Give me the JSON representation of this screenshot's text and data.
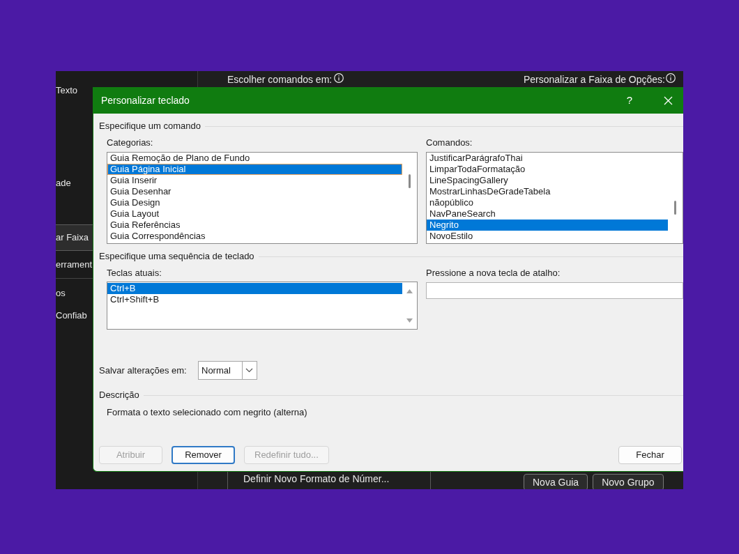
{
  "options_window": {
    "sidebar": [
      {
        "label": "Texto",
        "selected": false
      },
      {
        "label": "ade",
        "selected": false
      },
      {
        "label": "ar Faixa",
        "selected": true
      },
      {
        "label": "errament",
        "selected": false
      },
      {
        "label": "os",
        "selected": false
      },
      {
        "label": "Confiab",
        "selected": false
      }
    ],
    "choose_commands_label": "Escolher comandos em:",
    "customize_ribbon_label": "Personalizar a Faixa de Opções:",
    "commands_list": [
      "Definir Novo Formato de Númer..."
    ],
    "ribbon_buttons": [
      "Nova Guia",
      "Novo Grupo"
    ]
  },
  "dialog": {
    "title": "Personalizar teclado",
    "help_button": "?",
    "command_group": "Especifique um comando",
    "categories": {
      "label": "Categorias:",
      "focused": true,
      "items": [
        {
          "text": "Guia Remoção de Plano de Fundo",
          "selected": false
        },
        {
          "text": "Guia Página Inicial",
          "selected": true
        },
        {
          "text": "Guia Inserir",
          "selected": false
        },
        {
          "text": "Guia Desenhar",
          "selected": false
        },
        {
          "text": "Guia Design",
          "selected": false
        },
        {
          "text": "Guia Layout",
          "selected": false
        },
        {
          "text": "Guia Referências",
          "selected": false
        },
        {
          "text": "Guia Correspondências",
          "selected": false
        }
      ]
    },
    "commands": {
      "label": "Comandos:",
      "focused": false,
      "items": [
        {
          "text": "JustificarParágrafoThai",
          "selected": false
        },
        {
          "text": "LimparTodaFormatação",
          "selected": false
        },
        {
          "text": "LineSpacingGallery",
          "selected": false
        },
        {
          "text": "MostrarLinhasDeGradeTabela",
          "selected": false
        },
        {
          "text": "nãopúblico",
          "selected": false
        },
        {
          "text": "NavPaneSearch",
          "selected": false
        },
        {
          "text": "Negrito",
          "selected": true
        },
        {
          "text": "NovoEstilo",
          "selected": false
        }
      ]
    },
    "keyboard_group": "Especifique uma sequência de teclado",
    "current_keys": {
      "label": "Teclas atuais:",
      "focused": false,
      "items": [
        {
          "text": "Ctrl+B",
          "selected": true
        },
        {
          "text": "Ctrl+Shift+B",
          "selected": false
        }
      ]
    },
    "new_shortcut": {
      "label": "Pressione a nova tecla de atalho:"
    },
    "save_changes_in": {
      "label": "Salvar alterações em:",
      "value": "Normal"
    },
    "description_group": "Descrição",
    "description": "Formata o texto selecionado com negrito (alterna)",
    "buttons": [
      {
        "label": "Atribuir",
        "disabled": true,
        "focused": false
      },
      {
        "label": "Remover",
        "disabled": false,
        "focused": true
      },
      {
        "label": "Redefinir tudo...",
        "disabled": true,
        "focused": false
      }
    ],
    "close_button": "Fechar"
  }
}
